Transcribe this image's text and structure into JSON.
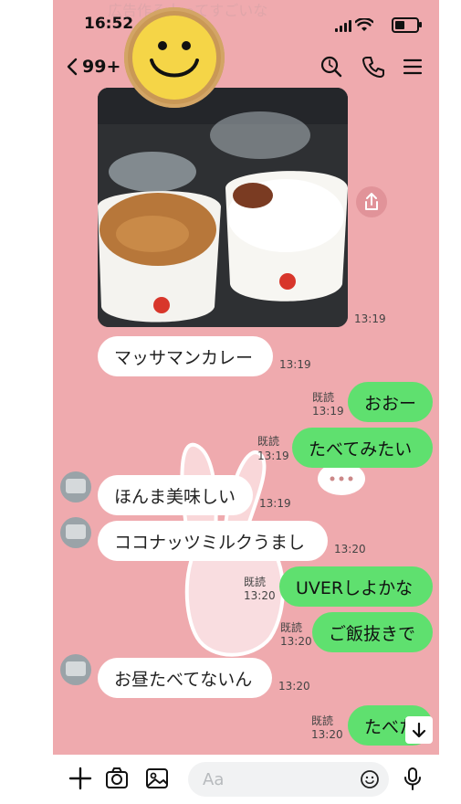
{
  "status": {
    "time": "16:52",
    "faded_text": "広告作る人ってすごいな"
  },
  "header": {
    "back_count": "99+"
  },
  "messages": [
    {
      "side": "left",
      "text": "マッサマンカレー",
      "time": "13:19"
    },
    {
      "side": "right",
      "text": "おおー",
      "read": "既読",
      "time": "13:19"
    },
    {
      "side": "right",
      "text": "たべてみたい",
      "read": "既読",
      "time": "13:19"
    },
    {
      "side": "left",
      "text": "ほんま美味しい",
      "time": "13:19"
    },
    {
      "side": "left",
      "text": "ココナッツミルクうまし",
      "time": "13:20"
    },
    {
      "side": "right",
      "text": "UVERしよかな",
      "read": "既読",
      "time": "13:20"
    },
    {
      "side": "right",
      "text": "ご飯抜きで",
      "read": "既読",
      "time": "13:20"
    },
    {
      "side": "left",
      "text": "お昼たべてないん",
      "time": "13:20"
    },
    {
      "side": "right",
      "text": "たべた",
      "read": "既読",
      "time": "13:20"
    }
  ],
  "photo": {
    "time": "13:19"
  },
  "input": {
    "placeholder": "Aa"
  },
  "colors": {
    "background": "#efaaae",
    "sent_bubble": "#5fe06f",
    "received_bubble": "#ffffff"
  }
}
